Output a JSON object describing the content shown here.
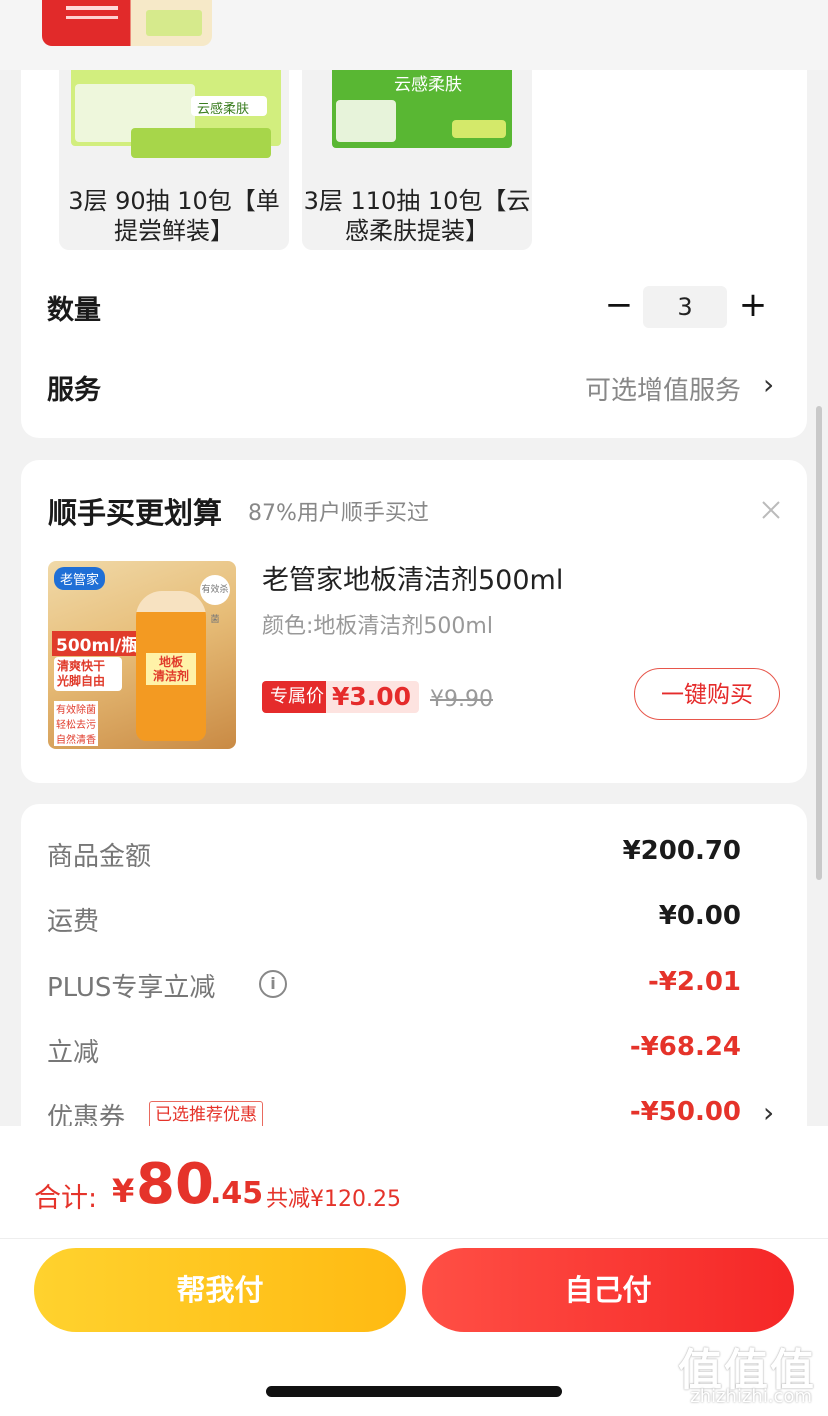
{
  "variants": [
    {
      "label": "3层 90抽 10包【单提尝鲜装】",
      "image_text": "云感柔肤"
    },
    {
      "label": "3层 110抽 10包【云感柔肤提装】",
      "image_text": "云感柔肤"
    }
  ],
  "quantity": {
    "label": "数量",
    "value": "3",
    "minus": "−",
    "plus": "+"
  },
  "service": {
    "label": "服务",
    "value": "可选增值服务",
    "chevron": "›"
  },
  "addon": {
    "title": "顺手买更划算",
    "subtitle": "87%用户顺手买过",
    "product_name": "老管家地板清洁剂500ml",
    "product_spec": "颜色:地板清洁剂500ml",
    "exclusive_tag": "专属价",
    "price": "¥3.00",
    "original_price": "¥9.90",
    "buy_button": "一键购买",
    "image_texts": [
      "老管家",
      "500ml/瓶",
      "清爽快干",
      "光脚自由",
      "地板",
      "清洁剂",
      "有效除菌",
      "轻松去污",
      "自然清香",
      "有效杀菌"
    ]
  },
  "fees": {
    "goods_label": "商品金额",
    "goods_value": "¥200.70",
    "shipping_label": "运费",
    "shipping_value": "¥0.00",
    "plus_label": "PLUS专享立减",
    "plus_value": "-¥2.01",
    "instant_label": "立减",
    "instant_value": "-¥68.24",
    "coupon_label": "优惠券",
    "coupon_tag": "已选推荐优惠",
    "coupon_value": "-¥50.00",
    "info_icon": "i",
    "chevron": "›"
  },
  "total": {
    "label": "合计:",
    "yen": "¥",
    "integer": "80",
    "decimal": ".45",
    "saved": "共减¥120.25"
  },
  "buttons": {
    "help_pay": "帮我付",
    "self_pay": "自己付"
  },
  "watermark": {
    "glyphs": "值值值",
    "site": "zhizhizhi.com"
  },
  "colors": {
    "accent_red": "#e5332a",
    "help_yellow": "#ffc61e",
    "self_red": "#f52727"
  }
}
